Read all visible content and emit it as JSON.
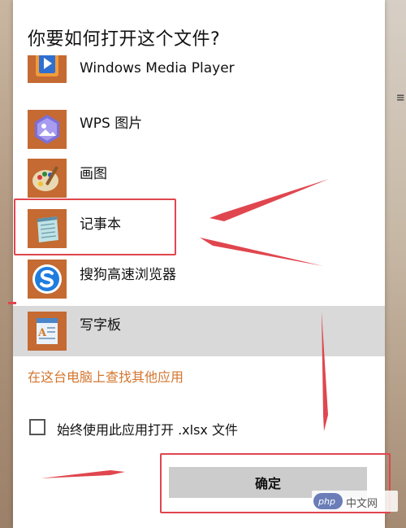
{
  "dialog": {
    "title": "你要如何打开这个文件?",
    "apps": [
      {
        "label": "Windows Media Player",
        "icon": "windows-media-player-icon",
        "selected": false
      },
      {
        "label": "WPS 图片",
        "icon": "wps-picture-icon",
        "selected": false
      },
      {
        "label": "画图",
        "icon": "paint-palette-icon",
        "selected": false
      },
      {
        "label": "记事本",
        "icon": "notepad-icon",
        "selected": false
      },
      {
        "label": "搜狗高速浏览器",
        "icon": "sogou-browser-icon",
        "selected": false
      },
      {
        "label": "写字板",
        "icon": "wordpad-icon",
        "selected": true
      }
    ],
    "find_link": "在这台电脑上查找其他应用",
    "always_use_label": "始终使用此应用打开 .xlsx 文件",
    "always_use_checked": false,
    "ok_label": "确定"
  },
  "watermark": {
    "logo_text": "php",
    "site_text": "中文网"
  },
  "colors": {
    "accent_orange": "#d3752e",
    "icon_tile": "#c46a32",
    "selected_row": "#d9d9d9",
    "annotation_red": "#e0464e"
  }
}
